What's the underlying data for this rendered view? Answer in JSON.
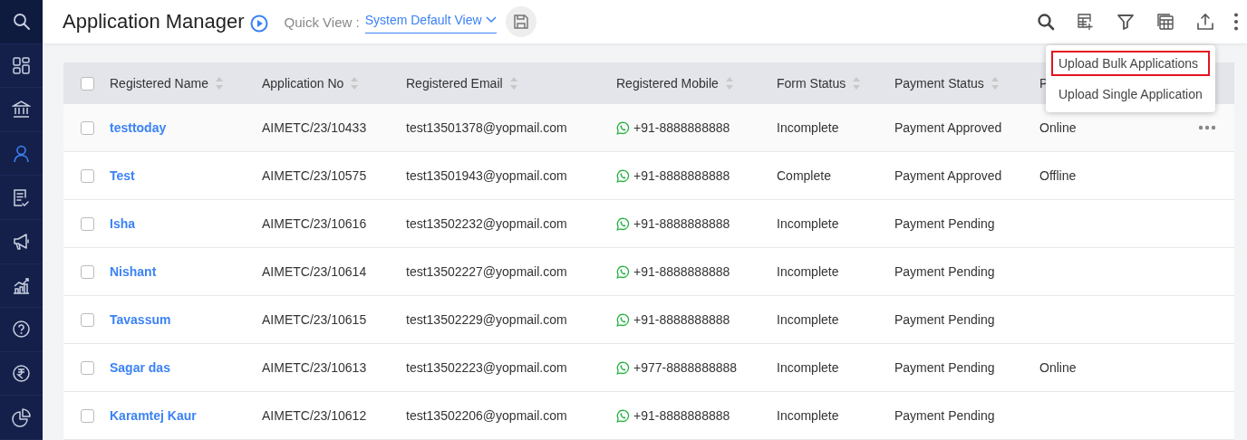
{
  "sidebar": {
    "items": [
      {
        "kind": "search",
        "selected": false
      },
      {
        "kind": "dashboard",
        "selected": false
      },
      {
        "kind": "institution",
        "selected": false
      },
      {
        "kind": "person",
        "selected": true
      },
      {
        "kind": "form",
        "selected": false
      },
      {
        "kind": "megaphone",
        "selected": false
      },
      {
        "kind": "chart",
        "selected": false
      },
      {
        "kind": "help",
        "selected": false
      },
      {
        "kind": "rupee",
        "selected": false
      },
      {
        "kind": "pie",
        "selected": false
      }
    ]
  },
  "header": {
    "title": "Application Manager",
    "quick_view_label": "Quick View :",
    "quick_view_value": "System Default View"
  },
  "upload_menu": {
    "items": [
      {
        "label": "Upload Bulk Applications",
        "highlighted": true
      },
      {
        "label": "Upload Single Application",
        "highlighted": false
      }
    ]
  },
  "table": {
    "select_all_checked": false,
    "columns": [
      {
        "label": "Registered Name",
        "sortable": true
      },
      {
        "label": "Application No",
        "sortable": true
      },
      {
        "label": "Registered Email",
        "sortable": true
      },
      {
        "label": "Registered Mobile",
        "sortable": true
      },
      {
        "label": "Form Status",
        "sortable": true
      },
      {
        "label": "Payment Status",
        "sortable": true
      },
      {
        "label": "P",
        "sortable": false
      }
    ],
    "rows": [
      {
        "checked": false,
        "hovered": true,
        "name": "testtoday",
        "application_no": "AIMETC/23/10433",
        "email": "test13501378@yopmail.com",
        "mobile": "+91-8888888888",
        "form_status": "Incomplete",
        "payment_status": "Payment Approved",
        "column_7": "Online"
      },
      {
        "checked": false,
        "hovered": false,
        "name": "Test",
        "application_no": "AIMETC/23/10575",
        "email": "test13501943@yopmail.com",
        "mobile": "+91-8888888888",
        "form_status": "Complete",
        "payment_status": "Payment Approved",
        "column_7": "Offline"
      },
      {
        "checked": false,
        "hovered": false,
        "name": "Isha",
        "application_no": "AIMETC/23/10616",
        "email": "test13502232@yopmail.com",
        "mobile": "+91-8888888888",
        "form_status": "Incomplete",
        "payment_status": "Payment Pending"
      },
      {
        "checked": false,
        "hovered": false,
        "name": "Nishant",
        "application_no": "AIMETC/23/10614",
        "email": "test13502227@yopmail.com",
        "mobile": "+91-8888888888",
        "form_status": "Incomplete",
        "payment_status": "Payment Pending"
      },
      {
        "checked": false,
        "hovered": false,
        "name": "Tavassum",
        "application_no": "AIMETC/23/10615",
        "email": "test13502229@yopmail.com",
        "mobile": "+91-8888888888",
        "form_status": "Incomplete",
        "payment_status": "Payment Pending"
      },
      {
        "checked": false,
        "hovered": false,
        "name": "Sagar das",
        "application_no": "AIMETC/23/10613",
        "email": "test13502223@yopmail.com",
        "mobile": "+977-8888888888",
        "form_status": "Incomplete",
        "payment_status": "Payment Pending",
        "column_7": "Online"
      },
      {
        "checked": false,
        "hovered": false,
        "name": "Karamtej Kaur",
        "application_no": "AIMETC/23/10612",
        "email": "test13502206@yopmail.com",
        "mobile": "+91-8888888888",
        "form_status": "Incomplete",
        "payment_status": "Payment Pending"
      }
    ]
  }
}
